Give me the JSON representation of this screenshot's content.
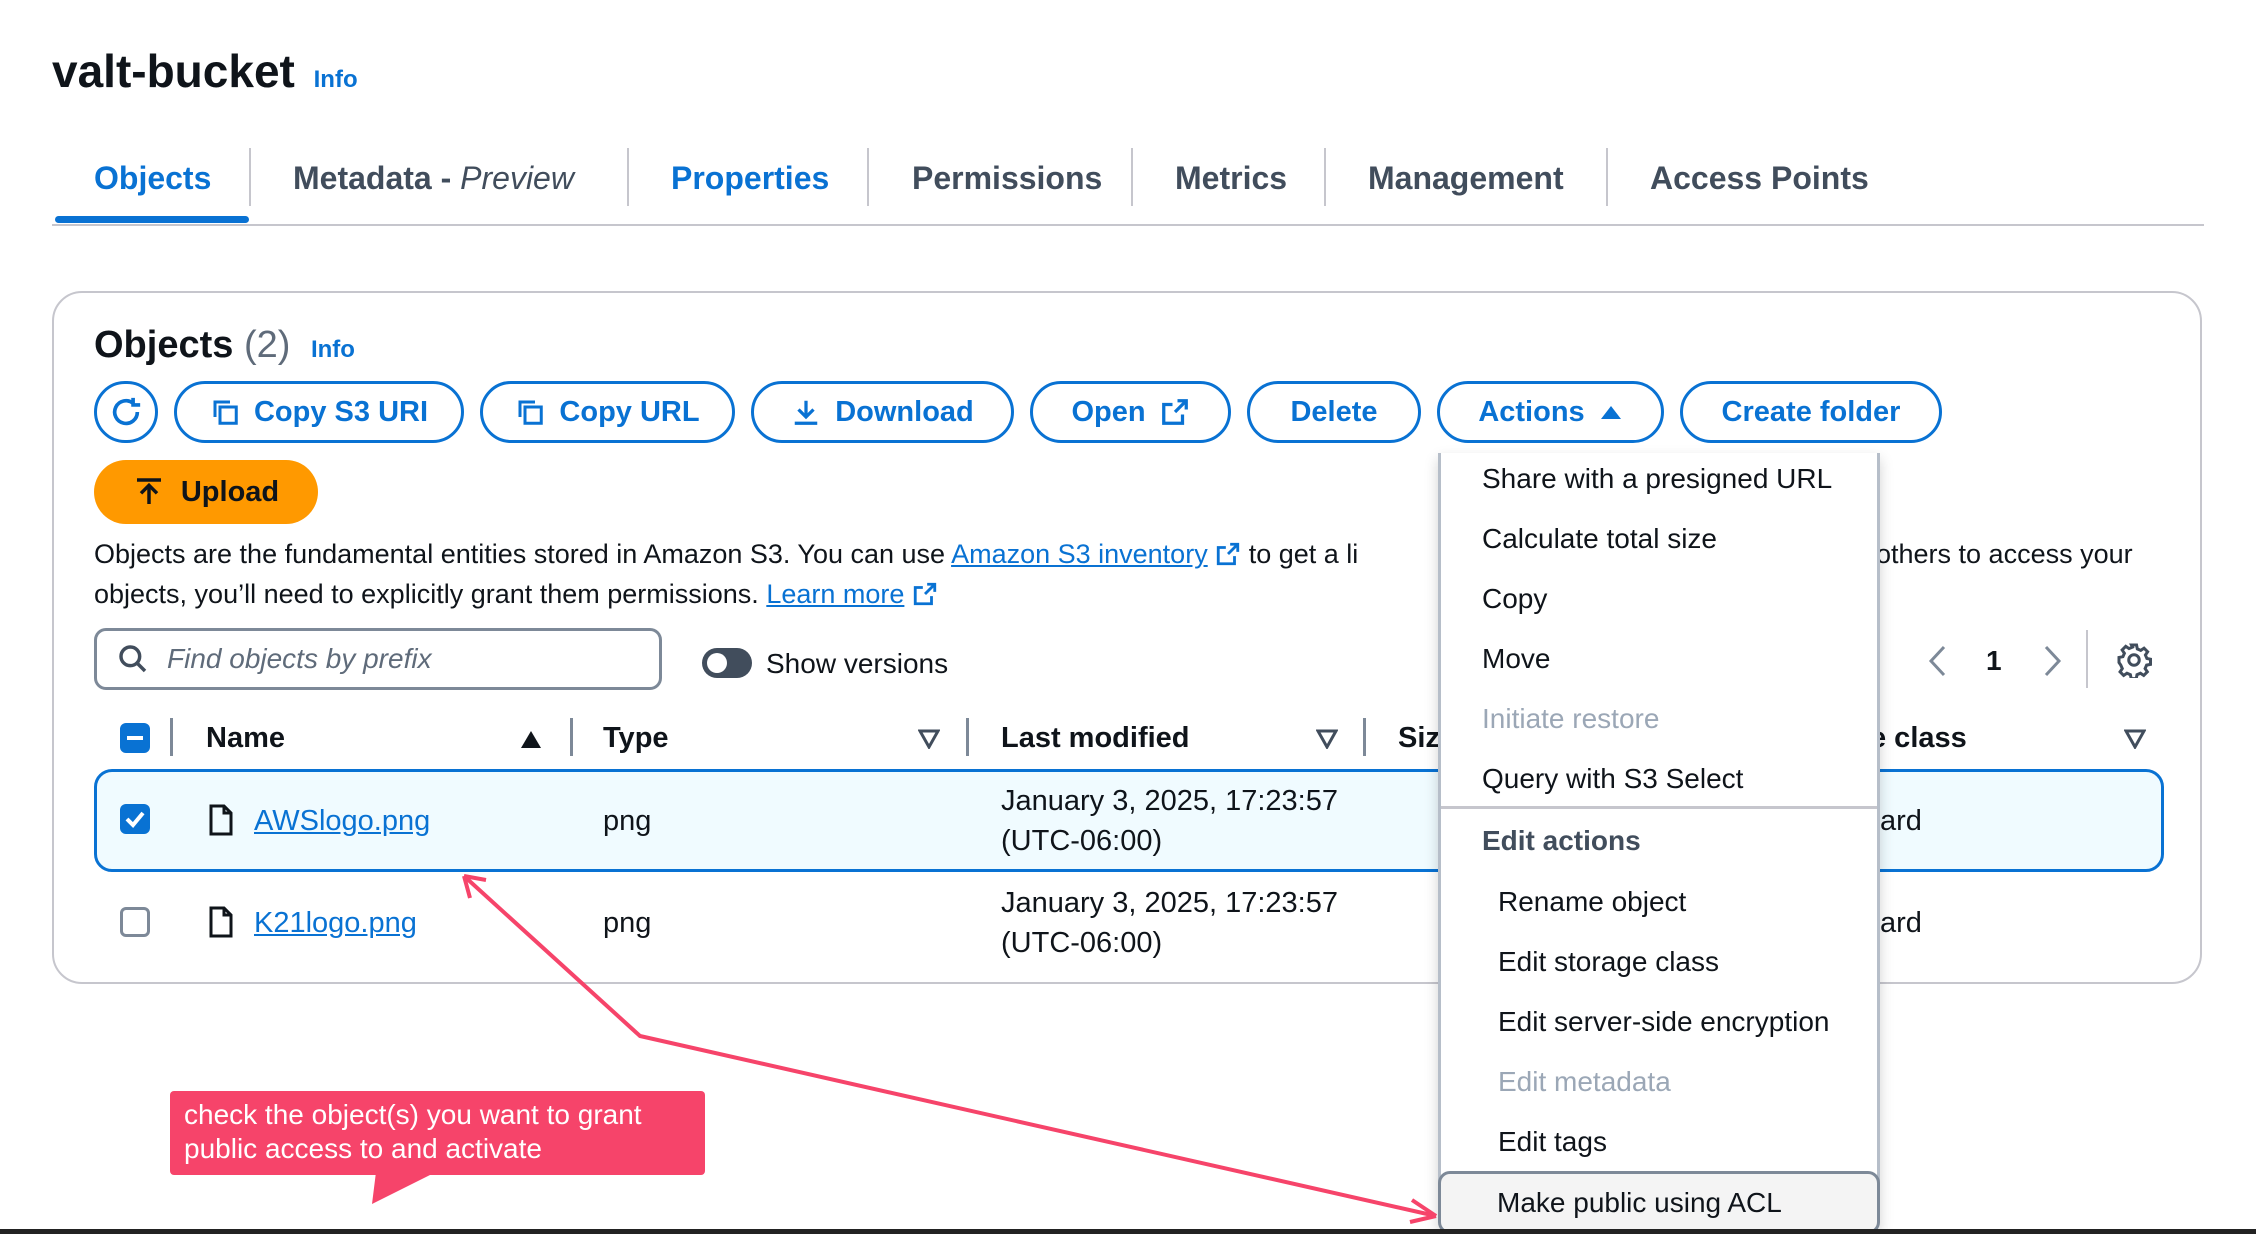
{
  "bucket": {
    "title": "valt-bucket",
    "info": "Info"
  },
  "tabs": [
    {
      "label": "Objects",
      "active": true
    },
    {
      "label": "Metadata - ",
      "label_italic": "Preview"
    },
    {
      "label": "Properties"
    },
    {
      "label": "Permissions"
    },
    {
      "label": "Metrics"
    },
    {
      "label": "Management"
    },
    {
      "label": "Access Points"
    }
  ],
  "objects_panel": {
    "title": "Objects",
    "count": "(2)",
    "info": "Info",
    "buttons": {
      "copy_s3_uri": "Copy S3 URI",
      "copy_url": "Copy URL",
      "download": "Download",
      "open": "Open",
      "delete": "Delete",
      "actions": "Actions",
      "create_folder": "Create folder",
      "upload": "Upload"
    },
    "description": {
      "part1": "Objects are the fundamental entities stored in Amazon S3. You can use ",
      "link1": "Amazon S3 inventory",
      "part2": " to get a li",
      "part3_right": "others to access your",
      "line2": "objects, you’ll need to explicitly grant them permissions. ",
      "link2": "Learn more"
    },
    "search": {
      "placeholder": "Find objects by prefix"
    },
    "show_versions": "Show versions",
    "page": "1",
    "columns": {
      "name": "Name",
      "type": "Type",
      "last_modified": "Last modified",
      "size": "Siz",
      "storage_class": "e class"
    },
    "rows": [
      {
        "name": "AWSlogo.png",
        "type": "png",
        "modified_line1": "January 3, 2025, 17:23:57",
        "modified_line2": "(UTC-06:00)",
        "storage_fragment": "ard",
        "checked": true
      },
      {
        "name": "K21logo.png",
        "type": "png",
        "modified_line1": "January 3, 2025, 17:23:57",
        "modified_line2": "(UTC-06:00)",
        "storage_fragment": "ard",
        "checked": false
      }
    ]
  },
  "actions_menu": {
    "items": [
      "Share with a presigned URL",
      "Calculate total size",
      "Copy",
      "Move",
      "Initiate restore",
      "Query with S3 Select"
    ],
    "group_label": "Edit actions",
    "edit_items": [
      "Rename object",
      "Edit storage class",
      "Edit server-side encryption",
      "Edit metadata",
      "Edit tags",
      "Make public using ACL"
    ]
  },
  "annotation": {
    "text": "check the object(s) you want to grant public access to and activate",
    "color": "#f6446a"
  },
  "colors": {
    "accent": "#0972d3",
    "upload": "#ff9900",
    "text": "#0f141a"
  }
}
